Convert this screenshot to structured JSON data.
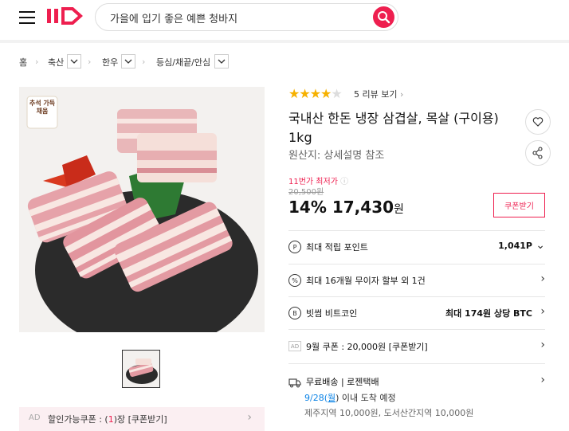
{
  "search": {
    "value": "가을에 입기 좋은 예쁜 청바지"
  },
  "breadcrumb": {
    "items": [
      "홈",
      "축산",
      "한우",
      "등심/채끝/안심"
    ]
  },
  "product": {
    "image_badge": "추석 가득채움",
    "title": "국내산 한돈 냉장 삼겹살, 목살 (구이용) 1kg",
    "origin": "원산지: 상세설명 참조",
    "rating": 4,
    "rating_max": 5,
    "review_link": "5 리뷰 보기"
  },
  "price": {
    "lowest_label": "11번가 최저가",
    "original": "20,500원",
    "discount": "14%",
    "sale": "17,430",
    "unit": "원",
    "coupon_button": "쿠폰받기"
  },
  "benefits": [
    {
      "icon": "point-icon",
      "label": "최대 적립 포인트",
      "value": "1,041P",
      "chevron": "down"
    },
    {
      "icon": "installment-icon",
      "label": "최대 16개월 무이자 할부 외 1건",
      "value": "",
      "chevron": "right"
    },
    {
      "icon": "bitcoin-icon",
      "label": "빗썸 비트코인",
      "value": "최대 174원 상당 BTC",
      "chevron": "right"
    },
    {
      "icon": "ad-badge",
      "label": "9월 쿠폰 : 20,000원 [쿠폰받기]",
      "value": "",
      "chevron": "right"
    }
  ],
  "shipping": {
    "label": "무료배송 | 로젠택배",
    "date_prefix": "9/28(",
    "date_day": "월",
    "date_suffix": ") 이내 도착 예정",
    "extra": "제주지역 10,000원, 도서산간지역 10,000원"
  },
  "coupon_bar": {
    "ad": "AD",
    "text_before": "할인가능쿠폰 : (",
    "count": "1",
    "text_after": ")장 [쿠폰받기]"
  },
  "colors": {
    "accent": "#ee1f4f",
    "star": "#f6b100",
    "blue": "#0b83e6"
  }
}
